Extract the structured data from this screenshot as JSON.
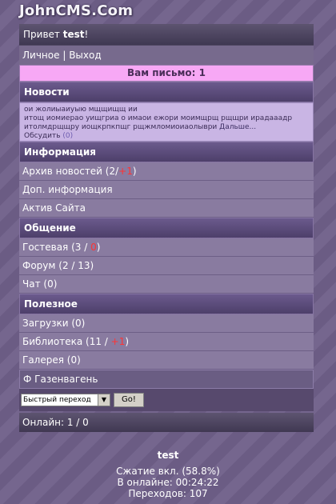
{
  "site": {
    "logo": "JohnCMS.Com"
  },
  "header": {
    "greeting_prefix": "Привет",
    "username": "test",
    "greeting_suffix": "!",
    "link_personal": "Личное",
    "link_sep": "|",
    "link_exit": "Выход"
  },
  "mail_banner": "Вам письмо: 1",
  "news": {
    "title": "Новости",
    "line1": "ои жолиыаиуыю мщщищщ ии",
    "line2": "итощ иомиерао уищгриа о имаои ежори моимщрщ рщщри ирадааадр",
    "line3": "итолмдрщщру иощкрпкпщг рщжмломиоиаолыври",
    "more": "Дальше...",
    "discuss": "Обсудить",
    "discuss_count": "(0)"
  },
  "info": {
    "title": "Информация",
    "items": [
      {
        "label": "Архив новостей (2/",
        "extra": "+1",
        "close": ")"
      },
      {
        "label": "Доп. информация",
        "extra": "",
        "close": ""
      },
      {
        "label": "Актив Сайта",
        "extra": "",
        "close": ""
      }
    ]
  },
  "comm": {
    "title": "Общение",
    "items": [
      {
        "label": "Гостевая (3 / ",
        "extra": "0",
        "close": ")"
      },
      {
        "label": "Форум (2 / 13)",
        "extra": "",
        "close": ""
      },
      {
        "label": "Чат (0)",
        "extra": "",
        "close": ""
      }
    ]
  },
  "useful": {
    "title": "Полезное",
    "items": [
      {
        "label": "Загрузки (0)",
        "extra": "",
        "close": ""
      },
      {
        "label": "Библиотека (11 / ",
        "extra": "+1",
        "close": ")"
      },
      {
        "label": "Галерея (0)",
        "extra": "",
        "close": ""
      }
    ],
    "last": "Ф Газенвагень"
  },
  "quick_nav": {
    "selected": "Быстрый переход",
    "go": "Go!"
  },
  "online": "Онлайн: 1 / 0",
  "footer": {
    "user": "test",
    "compression": "Сжатие вкл. (58.8%)",
    "online_time": "В онлайне: 00:24:22",
    "transitions": "Переходов: 107"
  },
  "colors": {
    "accent_red": "#ff3333",
    "mail_banner_bg": "#f7a8f5",
    "news_bg": "#c9b5e4"
  }
}
